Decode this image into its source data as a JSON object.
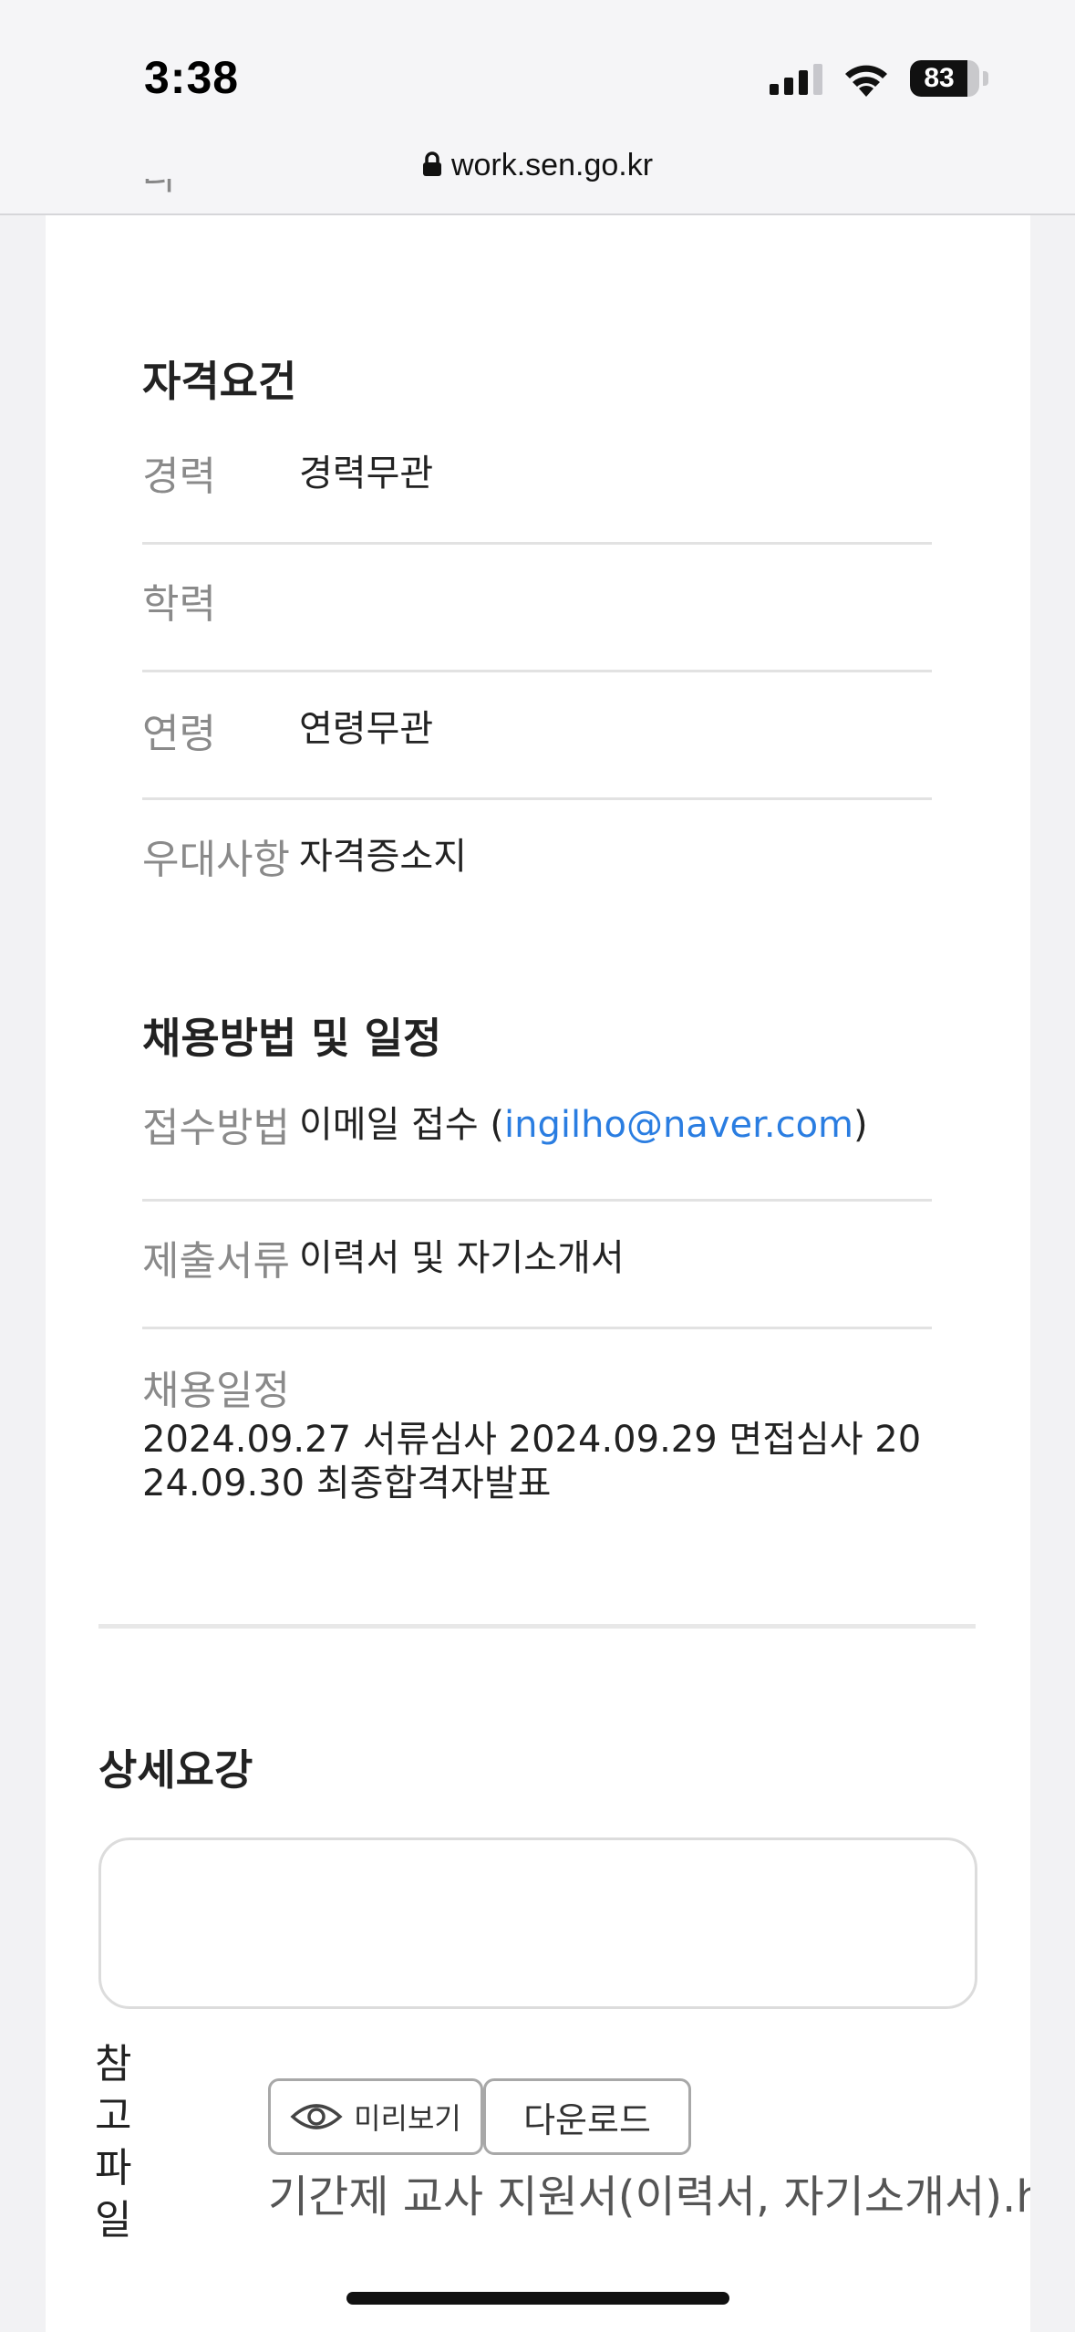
{
  "status_bar": {
    "time": "3:38",
    "battery": "83",
    "battery_level": 0.83
  },
  "url_bar": {
    "url": "work.sen.go.kr"
  },
  "qualifications": {
    "title": "자격요건",
    "rows": [
      {
        "label": "경력",
        "value": "경력무관"
      },
      {
        "label": "학력",
        "value": ""
      },
      {
        "label": "연령",
        "value": "연령무관"
      },
      {
        "label": "우대사항",
        "value": "자격증소지"
      }
    ]
  },
  "recruitment": {
    "title": "채용방법 및 일정",
    "method_label": "접수방법",
    "method_prefix": "이메일 접수 (",
    "method_email": "ingilho@naver.com",
    "method_suffix": ")",
    "documents_label": "제출서류",
    "documents_value": "이력서 및 자기소개서",
    "schedule_label": "채용일정",
    "schedule_value": "2024.09.27 서류심사 2024.09.29 면접심사 2024.09.30 최종합격자발표"
  },
  "details": {
    "title": "상세요강",
    "content": ""
  },
  "attachment": {
    "label_chars": [
      "참",
      "고",
      "파",
      "일"
    ],
    "preview_label": "미리보기",
    "download_label": "다운로드",
    "file_name": "기간제 교사 지원서(이력서, 자기소개서).hwp"
  },
  "icons": {
    "lock": "lock-icon",
    "eye": "eye-icon",
    "wifi": "wifi-icon",
    "signal": "cellular-signal-icon"
  },
  "colors": {
    "link": "#2a7de1"
  }
}
